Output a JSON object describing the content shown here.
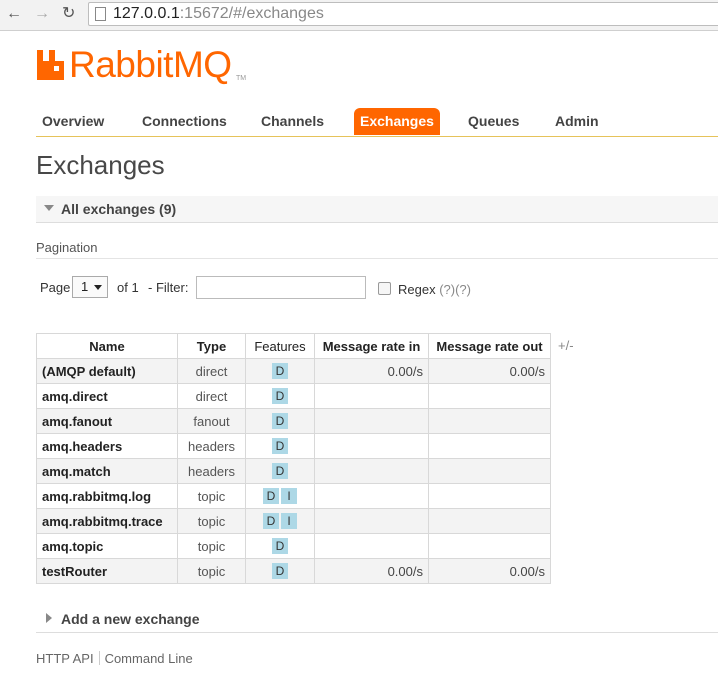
{
  "browser": {
    "back_icon": "back-arrow-icon",
    "forward_icon": "forward-arrow-icon",
    "reload_icon": "reload-icon",
    "url_host": "127.0.0.1",
    "url_rest": ":15672/#/exchanges"
  },
  "logo": {
    "text": "RabbitMQ",
    "tm": "TM",
    "color": "#ff6600"
  },
  "tabs": [
    {
      "label": "Overview",
      "active": false
    },
    {
      "label": "Connections",
      "active": false
    },
    {
      "label": "Channels",
      "active": false
    },
    {
      "label": "Exchanges",
      "active": true
    },
    {
      "label": "Queues",
      "active": false
    },
    {
      "label": "Admin",
      "active": false
    }
  ],
  "page_title": "Exchanges",
  "section": {
    "label": "All exchanges (9)"
  },
  "pagination": {
    "label": "Pagination",
    "page_label": "Page",
    "page_value": "1",
    "of_label": "of 1",
    "filter_label": "- Filter:",
    "filter_value": "",
    "regex_label": "Regex",
    "regex_help": "(?)(?)"
  },
  "table": {
    "headers": [
      "Name",
      "Type",
      "Features",
      "Message rate in",
      "Message rate out"
    ],
    "toggle": "+/-",
    "rows": [
      {
        "name": "(AMQP default)",
        "type": "direct",
        "features": [
          "D"
        ],
        "rate_in": "0.00/s",
        "rate_out": "0.00/s"
      },
      {
        "name": "amq.direct",
        "type": "direct",
        "features": [
          "D"
        ],
        "rate_in": "",
        "rate_out": ""
      },
      {
        "name": "amq.fanout",
        "type": "fanout",
        "features": [
          "D"
        ],
        "rate_in": "",
        "rate_out": ""
      },
      {
        "name": "amq.headers",
        "type": "headers",
        "features": [
          "D"
        ],
        "rate_in": "",
        "rate_out": ""
      },
      {
        "name": "amq.match",
        "type": "headers",
        "features": [
          "D"
        ],
        "rate_in": "",
        "rate_out": ""
      },
      {
        "name": "amq.rabbitmq.log",
        "type": "topic",
        "features": [
          "D",
          "I"
        ],
        "rate_in": "",
        "rate_out": ""
      },
      {
        "name": "amq.rabbitmq.trace",
        "type": "topic",
        "features": [
          "D",
          "I"
        ],
        "rate_in": "",
        "rate_out": ""
      },
      {
        "name": "amq.topic",
        "type": "topic",
        "features": [
          "D"
        ],
        "rate_in": "",
        "rate_out": ""
      },
      {
        "name": "testRouter",
        "type": "topic",
        "features": [
          "D"
        ],
        "rate_in": "0.00/s",
        "rate_out": "0.00/s"
      }
    ]
  },
  "add_section": {
    "label": "Add a new exchange"
  },
  "footer": {
    "links": [
      "HTTP API",
      "Command Line"
    ]
  },
  "colors": {
    "accent": "#ff6600",
    "badge": "#add8e6",
    "tab_rule": "#e6c35a"
  }
}
